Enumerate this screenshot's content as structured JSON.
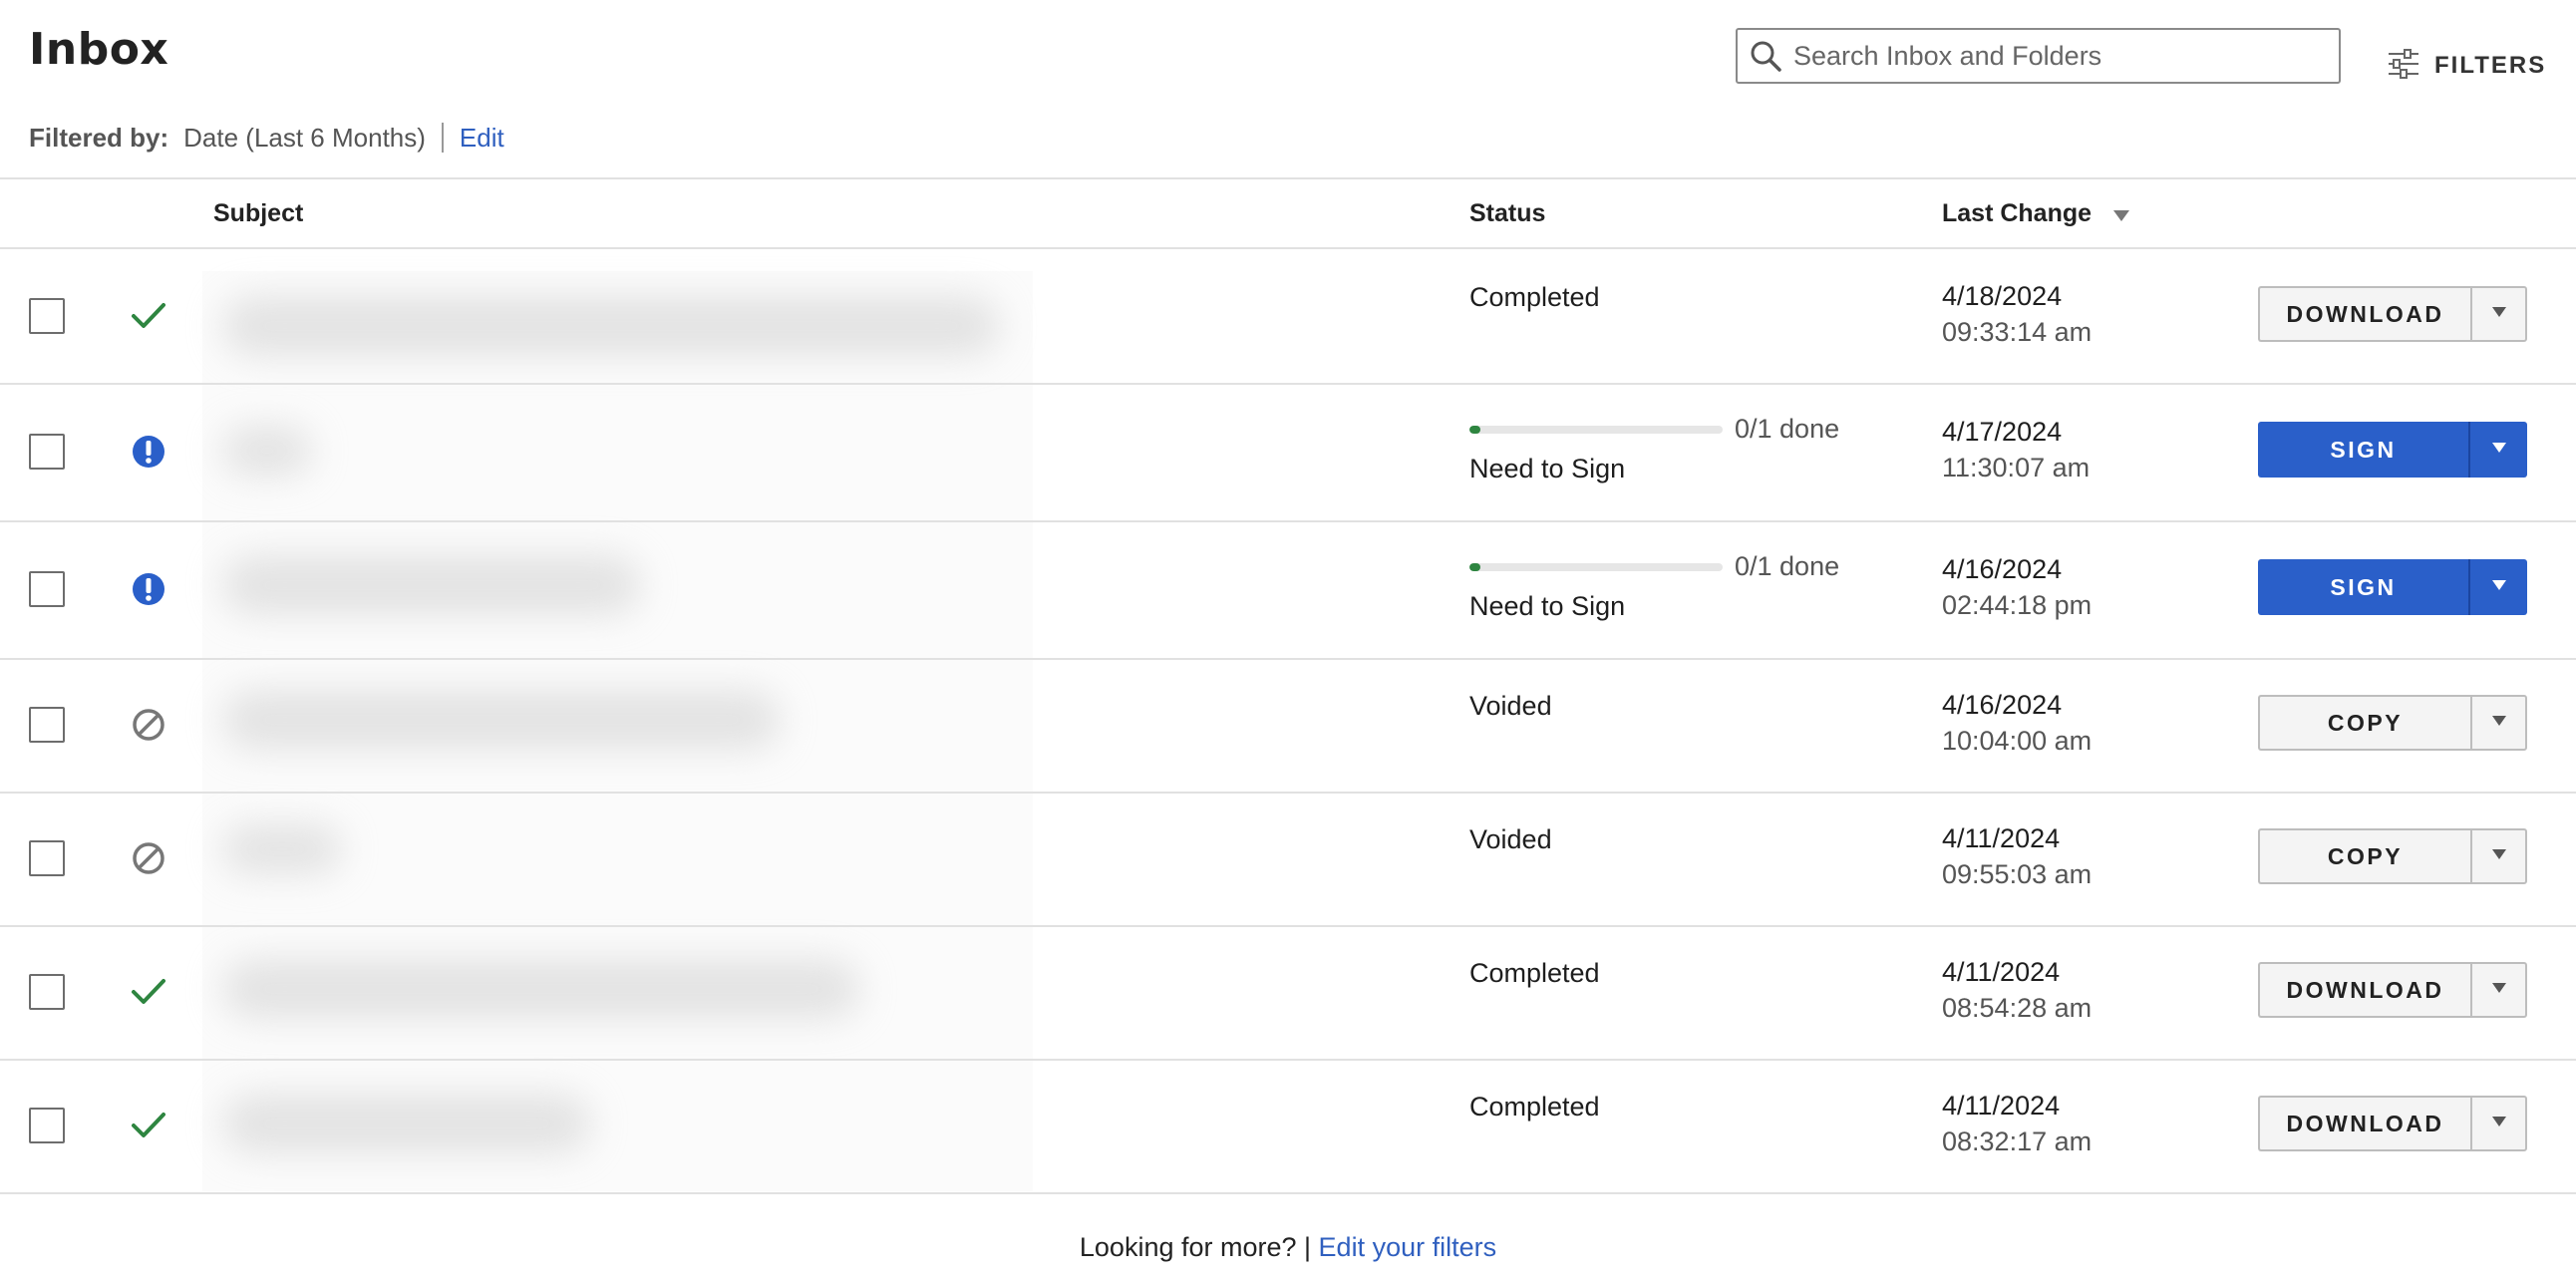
{
  "header": {
    "title": "Inbox",
    "search_placeholder": "Search Inbox and Folders",
    "filters_label": "FILTERS"
  },
  "filter_bar": {
    "label": "Filtered by:",
    "value": "Date (Last 6 Months)",
    "edit_label": "Edit"
  },
  "table": {
    "columns": [
      "Subject",
      "Status",
      "Last Change"
    ],
    "sort_indicator": "down-caret",
    "rows": [
      {
        "status_icon": "check-icon",
        "status": "Completed",
        "date": "4/18/2024",
        "time": "09:33:14 am",
        "action": "DOWNLOAD",
        "action_style": "secondary"
      },
      {
        "status_icon": "alert-icon",
        "status": "Need to Sign",
        "progress_text": "0/1 done",
        "progress": 0.0,
        "date": "4/17/2024",
        "time": "11:30:07 am",
        "action": "SIGN",
        "action_style": "primary"
      },
      {
        "status_icon": "alert-icon",
        "status": "Need to Sign",
        "progress_text": "0/1 done",
        "progress": 0.0,
        "date": "4/16/2024",
        "time": "02:44:18 pm",
        "action": "SIGN",
        "action_style": "primary"
      },
      {
        "status_icon": "void-icon",
        "status": "Voided",
        "date": "4/16/2024",
        "time": "10:04:00 am",
        "action": "COPY",
        "action_style": "secondary"
      },
      {
        "status_icon": "void-icon",
        "status": "Voided",
        "date": "4/11/2024",
        "time": "09:55:03 am",
        "action": "COPY",
        "action_style": "secondary"
      },
      {
        "status_icon": "check-icon",
        "status": "Completed",
        "date": "4/11/2024",
        "time": "08:54:28 am",
        "action": "DOWNLOAD",
        "action_style": "secondary"
      },
      {
        "status_icon": "check-icon",
        "status": "Completed",
        "date": "4/11/2024",
        "time": "08:32:17 am",
        "action": "DOWNLOAD",
        "action_style": "secondary"
      }
    ]
  },
  "footer": {
    "text": "Looking for more? |",
    "link": "Edit your filters"
  },
  "colors": {
    "primary": "#2a5fc9",
    "success": "#2e8540",
    "link": "#2f5fbf",
    "void": "#777777"
  }
}
